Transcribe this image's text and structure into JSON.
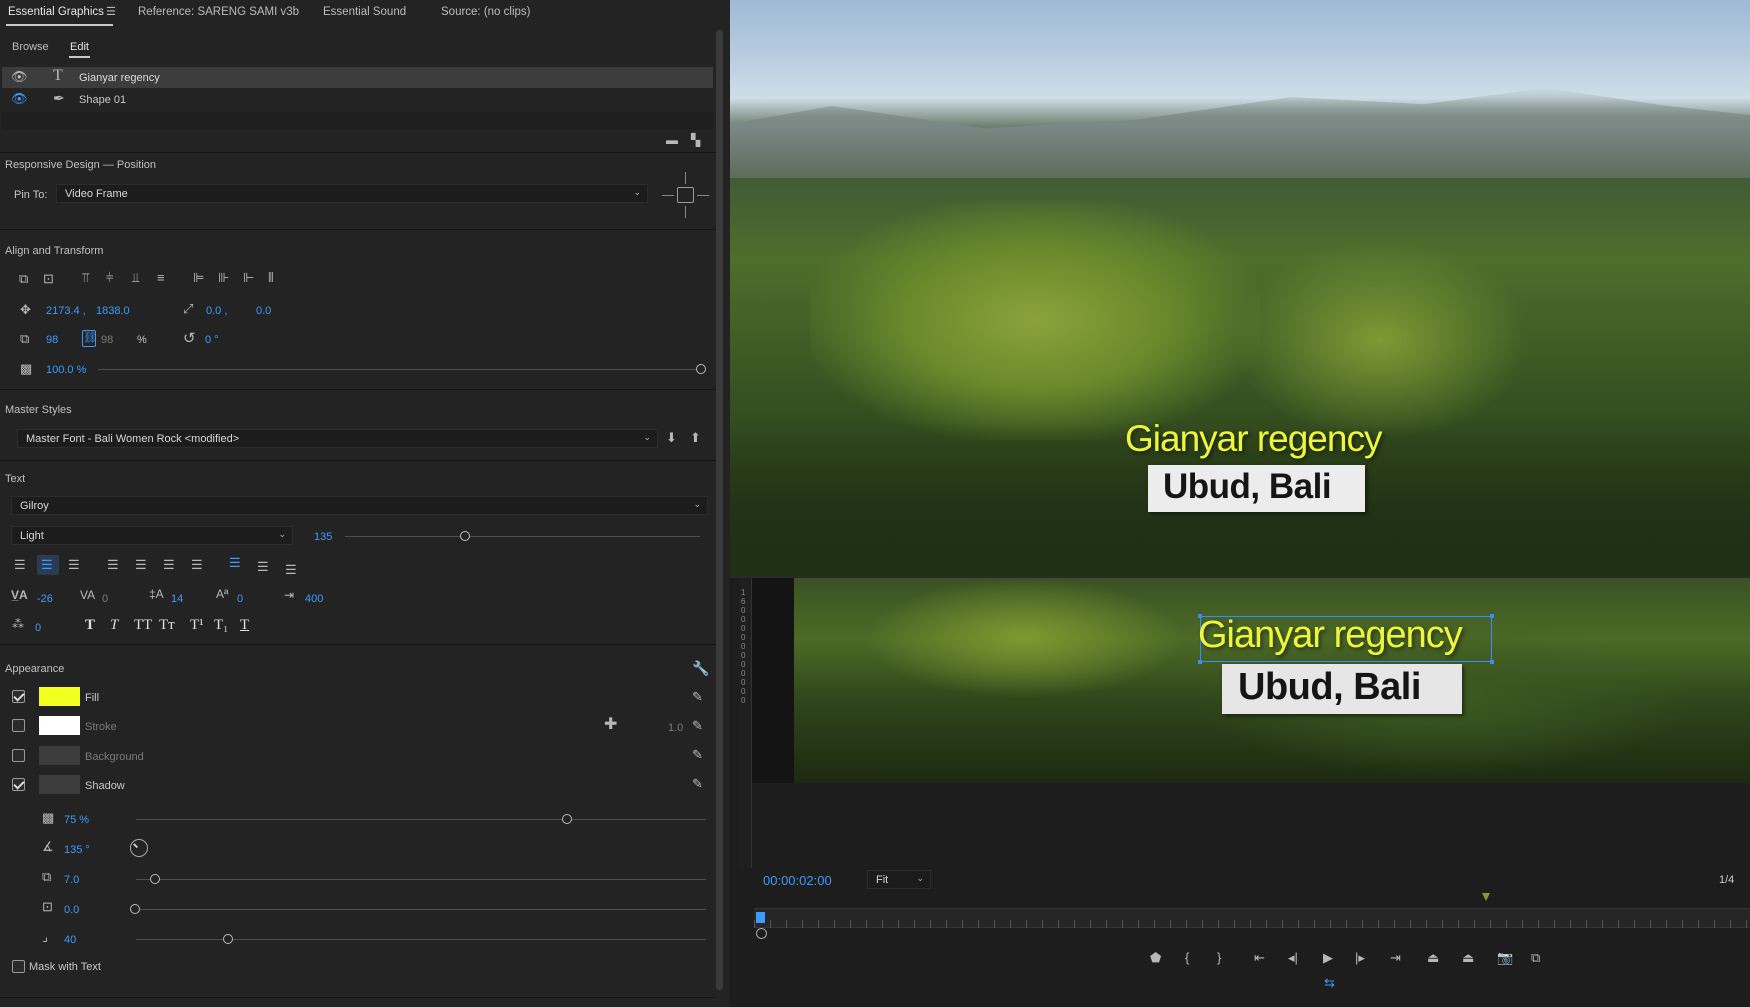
{
  "tabs": [
    {
      "label": "Essential Graphics"
    },
    {
      "label": "Reference: SARENG SAMI v3b"
    },
    {
      "label": "Essential Sound"
    },
    {
      "label": "Source: (no clips)"
    }
  ],
  "subtabs": {
    "browse": "Browse",
    "edit": "Edit"
  },
  "layers": [
    {
      "name": "Gianyar regency",
      "icon": "text-icon"
    },
    {
      "name": "Shape 01",
      "icon": "pen-icon"
    }
  ],
  "responsive": {
    "title": "Responsive Design — Position",
    "pin_label": "Pin To:",
    "pin_value": "Video Frame"
  },
  "align": {
    "title": "Align and Transform",
    "pos_x": "2173.4 ,",
    "pos_y": "1838.0",
    "anchor_x": "0.0 ,",
    "anchor_y": "0.0",
    "scale": "98",
    "scale_locked": "98",
    "pct": "%",
    "rotation": "0 °",
    "opacity": "100.0 %"
  },
  "master": {
    "title": "Master Styles",
    "value": "Master Font - Bali Women Rock <modified>"
  },
  "text": {
    "title": "Text",
    "font": "Gilroy",
    "weight": "Light",
    "size": "135",
    "kerning": "-26",
    "tracking": "0",
    "leading": "14",
    "baseline": "0",
    "tab_width": "400",
    "tsume": "0"
  },
  "appearance": {
    "title": "Appearance",
    "fill": {
      "label": "Fill",
      "color": "#f2ff1f",
      "checked": true
    },
    "stroke": {
      "label": "Stroke",
      "color": "#ffffff",
      "width": "1.0",
      "checked": false
    },
    "background": {
      "label": "Background",
      "checked": false
    },
    "shadow": {
      "label": "Shadow",
      "checked": true
    },
    "shadow_opacity": "75 %",
    "shadow_angle": "135 °",
    "shadow_distance": "7.0",
    "shadow_size": "0.0",
    "shadow_blur": "40",
    "mask": "Mask with Text"
  },
  "program": {
    "line1": "Gianyar regency",
    "line2": "Ubud, Bali"
  },
  "source": {
    "line1": "Gianyar regency",
    "line2": "Ubud, Bali",
    "ruler": "1600 0 0 0 0 0 0 0 0 0"
  },
  "timeline": {
    "timecode": "00:00:02:00",
    "zoom": "Fit",
    "fraction": "1/4"
  }
}
